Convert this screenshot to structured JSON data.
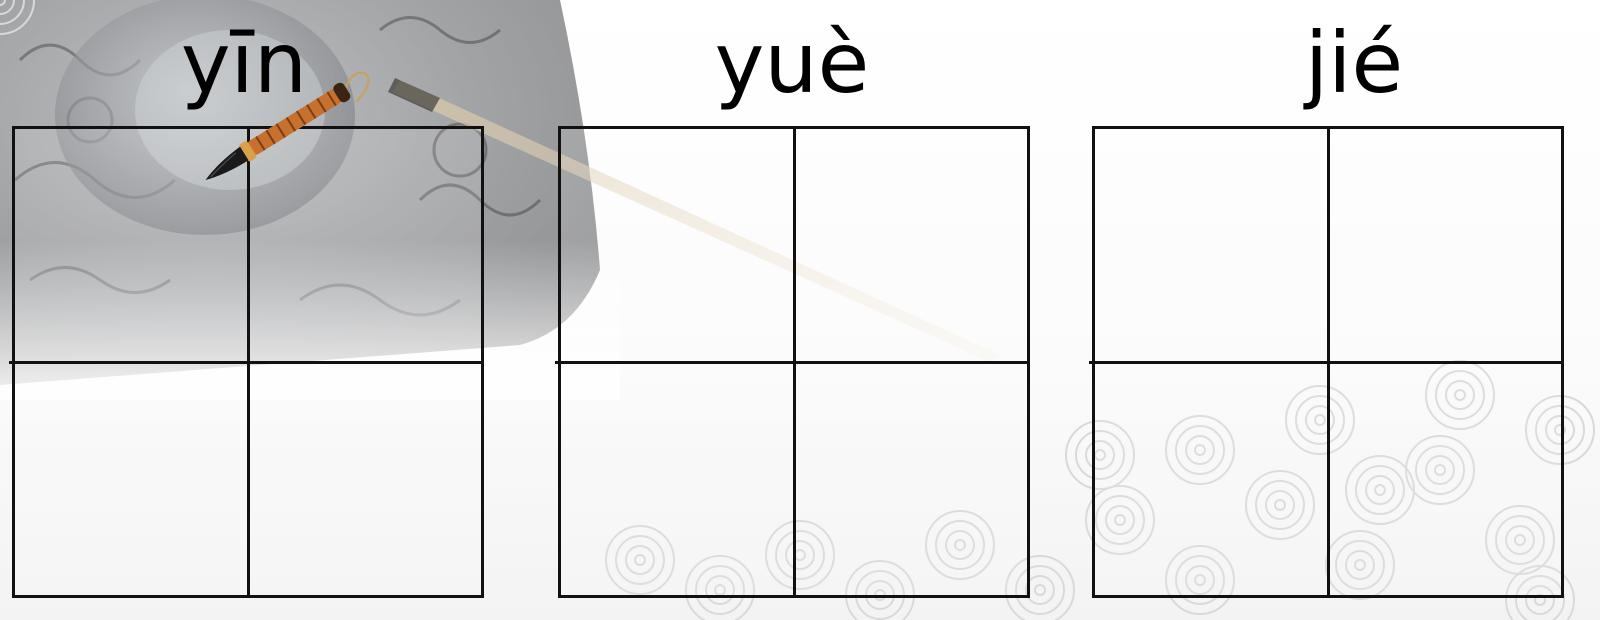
{
  "pinyin_cards": [
    {
      "pinyin": "yīn"
    },
    {
      "pinyin": "yuè"
    },
    {
      "pinyin": "jié"
    }
  ],
  "decorations": {
    "inkstone_color": "#3a3a3c",
    "brush_handle_color": "#c8712e",
    "brush_tip_color": "#1a1a1a",
    "grid_line_color": "#111111",
    "swirl_color": "#d9d9d9"
  }
}
